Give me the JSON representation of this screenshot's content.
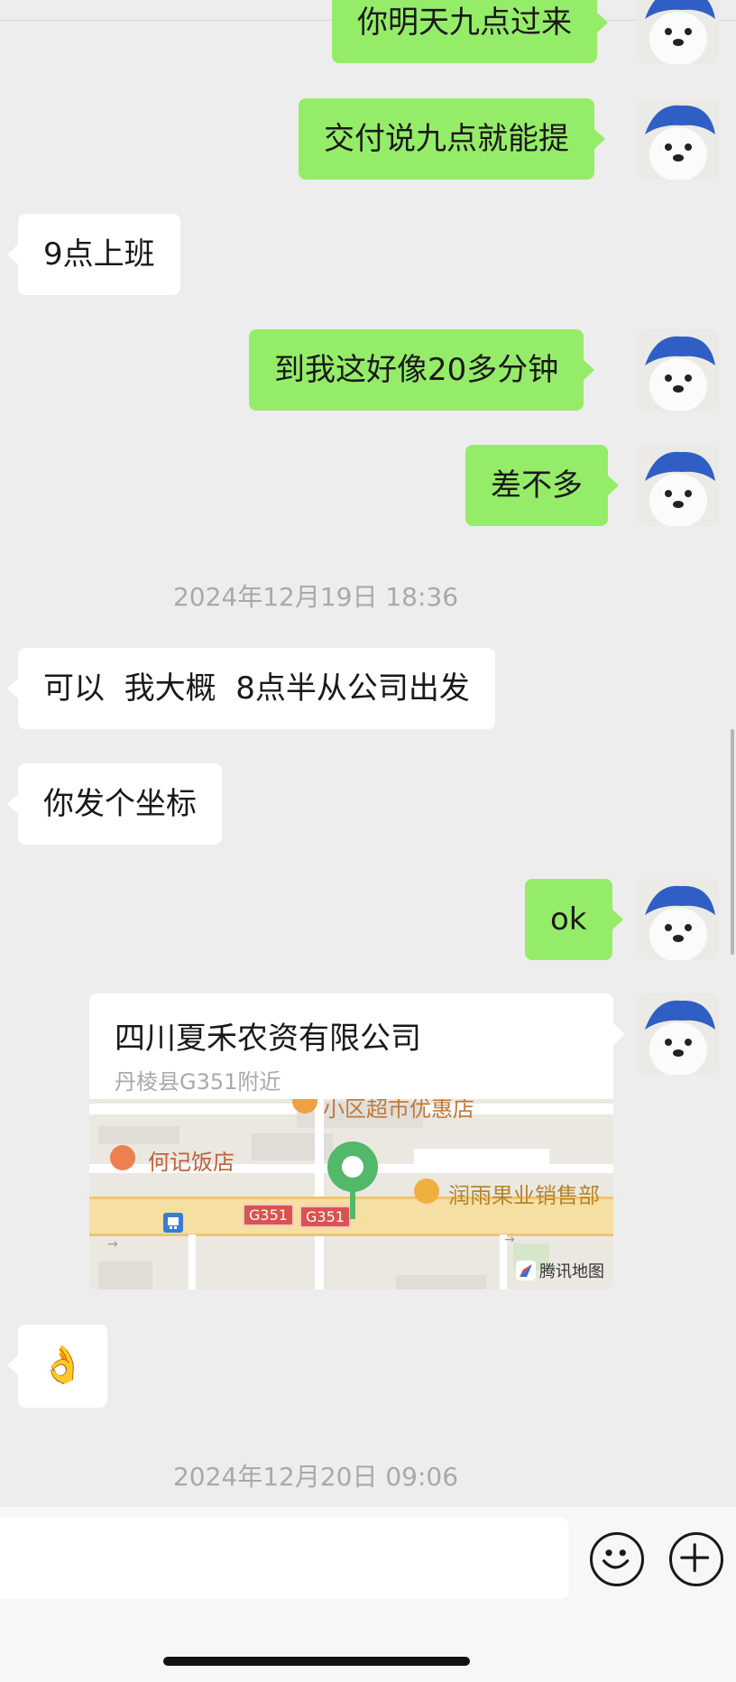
{
  "messages": [
    {
      "side": "right",
      "text": "你明天九点过来"
    },
    {
      "side": "right",
      "text": "交付说九点就能提"
    },
    {
      "side": "left",
      "text": "9点上班"
    },
    {
      "side": "right",
      "text": "到我这好像20多分钟"
    },
    {
      "side": "right",
      "text": "差不多"
    },
    {
      "side": "left",
      "text": "可以  我大概  8点半从公司出发"
    },
    {
      "side": "left",
      "text": "你发个坐标"
    },
    {
      "side": "right",
      "text": "ok"
    }
  ],
  "timestamps": [
    "2024年12月19日 18:36",
    "2024年12月20日 09:06"
  ],
  "location": {
    "title": "四川夏禾农资有限公司",
    "subtitle": "丹棱县G351附近",
    "map_labels": {
      "poi_top": "小区超市优惠店",
      "poi_left": "何记饭店",
      "poi_right": "润雨果业销售部",
      "road_shield_1": "G351",
      "road_shield_2": "G351",
      "watermark": "腾讯地图"
    }
  },
  "reaction": {
    "emoji": "👌",
    "icon": "ok-hand-emoji"
  },
  "input": {
    "placeholder": "",
    "emoji_button_icon": "smiley-icon",
    "more_button_icon": "plus-circle-icon"
  },
  "colors": {
    "bubble_right": "#95ec69",
    "bubble_left": "#ffffff",
    "background": "#ededed",
    "timestamp": "#a9a9a9",
    "map_pin": "#52b86a"
  }
}
